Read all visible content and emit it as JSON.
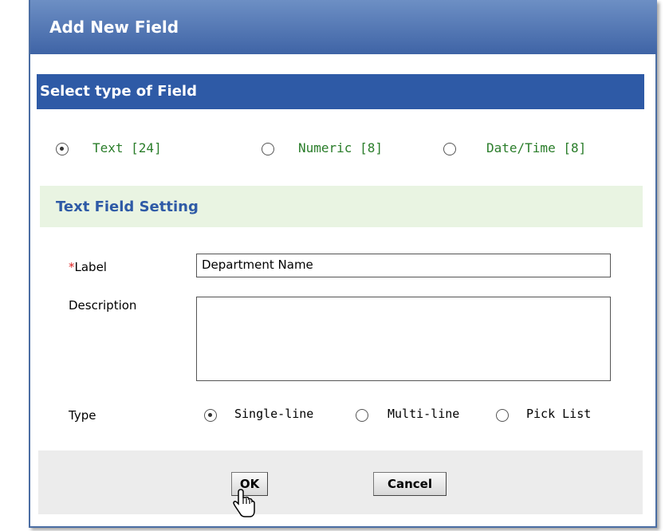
{
  "dialog": {
    "title": "Add New Field"
  },
  "field_type_section": {
    "heading": "Select type of Field",
    "options": [
      {
        "label": "Text [24]",
        "checked": true
      },
      {
        "label": "Numeric [8]",
        "checked": false
      },
      {
        "label": "Date/Time [8]",
        "checked": false
      }
    ]
  },
  "setting_section": {
    "heading": "Text Field Setting"
  },
  "form": {
    "label_required_marker": "*",
    "label_caption": "Label",
    "label_value": "Department Name",
    "description_caption": "Description",
    "description_value": "",
    "type_caption": "Type",
    "type_options": [
      {
        "label": "Single-line",
        "checked": true
      },
      {
        "label": "Multi-line",
        "checked": false
      },
      {
        "label": "Pick List",
        "checked": false
      }
    ]
  },
  "buttons": {
    "ok_label": "OK",
    "cancel_label": "Cancel"
  },
  "colors": {
    "title_bar": "#3f64a6",
    "section_header": "#2e5aa6",
    "subsection_bg": "#e9f4e2",
    "field_type_text": "#2a7d2a",
    "required_marker": "#dd2222"
  },
  "icons": {
    "cursor": "hand-pointer-icon"
  }
}
